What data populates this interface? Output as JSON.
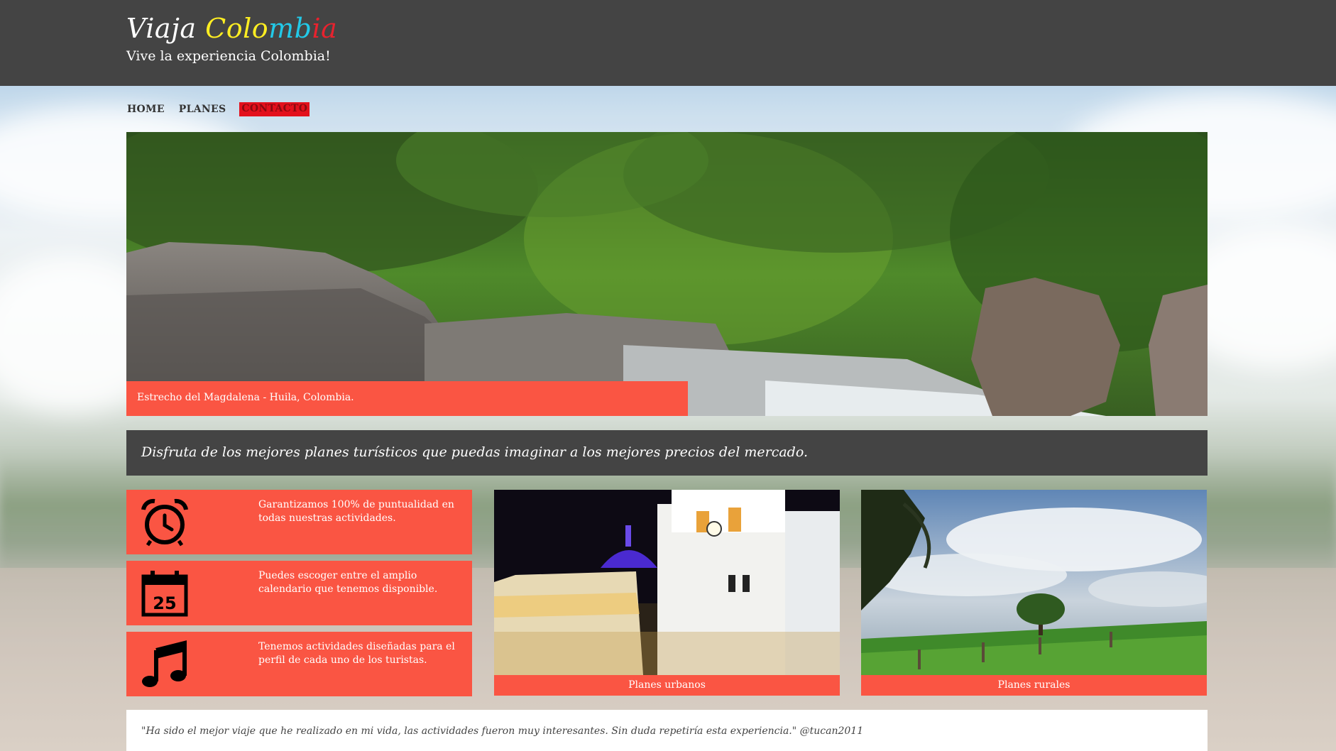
{
  "brand": {
    "title_part1": "Viaja",
    "title_part2_letters": [
      "Colo",
      "mb",
      "ia"
    ],
    "tagline": "Vive la experiencia Colombia!"
  },
  "nav": {
    "items": [
      {
        "label": "HOME",
        "active": false
      },
      {
        "label": "PLANES",
        "active": false
      },
      {
        "label": "CONTACTO",
        "active": true
      }
    ]
  },
  "hero": {
    "caption": "Estrecho del Magdalena - Huila, Colombia."
  },
  "banner": {
    "text": "Disfruta de los mejores planes turísticos que puedas imaginar a los mejores precios del mercado."
  },
  "features": [
    {
      "icon": "alarm-clock-icon",
      "text": "Garantizamos 100% de puntualidad en todas nuestras actividades."
    },
    {
      "icon": "calendar-icon",
      "icon_number": "25",
      "text": "Puedes escoger entre el amplio calendario que tenemos disponible."
    },
    {
      "icon": "music-note-icon",
      "text": "Tenemos actividades diseñadas para el perfil de cada uno de los turistas."
    }
  ],
  "cards": [
    {
      "caption": "Planes urbanos"
    },
    {
      "caption": "Planes rurales"
    }
  ],
  "testimonial": {
    "text": "\"Ha sido el mejor viaje que he realizado en mi vida, las actividades fueron muy interesantes. Sin duda repetiría esta experiencia.\" @tucan2011"
  },
  "colors": {
    "header_bg": "#444444",
    "accent": "#fa5543",
    "nav_active": "#e3101c",
    "brand_yellow": "#ffee22",
    "brand_cyan": "#22c9e8",
    "brand_red": "#e8222e"
  }
}
